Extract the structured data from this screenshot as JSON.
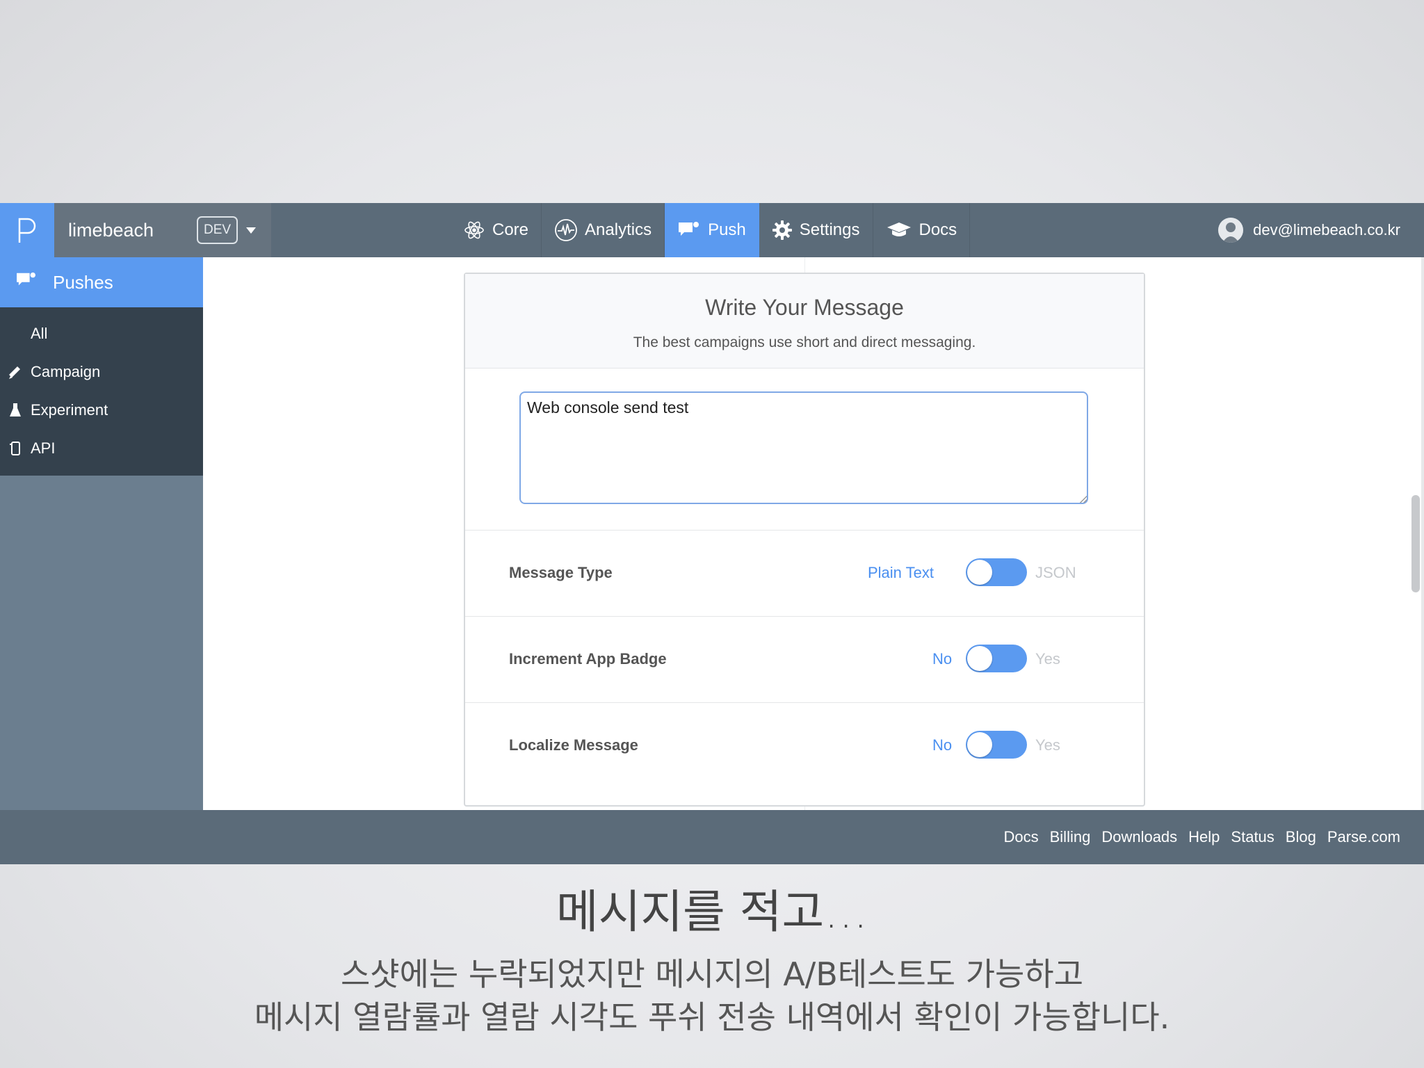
{
  "app": {
    "name": "limebeach",
    "environment": "DEV",
    "user_email": "dev@limebeach.co.kr"
  },
  "nav": {
    "items": [
      {
        "label": "Core",
        "icon": "atom-icon"
      },
      {
        "label": "Analytics",
        "icon": "pulse-icon"
      },
      {
        "label": "Push",
        "icon": "chat-bubble-icon",
        "active": true
      },
      {
        "label": "Settings",
        "icon": "gear-icon"
      },
      {
        "label": "Docs",
        "icon": "graduation-cap-icon"
      }
    ]
  },
  "sidebar": {
    "header": "Pushes",
    "items": [
      {
        "label": "All",
        "icon": ""
      },
      {
        "label": "Campaign",
        "icon": "megaphone-icon"
      },
      {
        "label": "Experiment",
        "icon": "flask-icon"
      },
      {
        "label": "API",
        "icon": "phone-icon"
      }
    ]
  },
  "card": {
    "title": "Write Your Message",
    "subtitle": "The best campaigns use short and direct messaging.",
    "message_value": "Web console send test"
  },
  "options": [
    {
      "label": "Message Type",
      "left": "Plain Text",
      "right": "JSON",
      "selected": "Plain Text"
    },
    {
      "label": "Increment App Badge",
      "left": "No",
      "right": "Yes",
      "selected": "No"
    },
    {
      "label": "Localize Message",
      "left": "No",
      "right": "Yes",
      "selected": "No"
    }
  ],
  "footer": {
    "links": [
      "Docs",
      "Billing",
      "Downloads",
      "Help",
      "Status",
      "Blog",
      "Parse.com"
    ]
  },
  "caption": {
    "title": "메시지를 적고...",
    "line1": "스샷에는 누락되었지만 메시지의 A/B테스트도 가능하고",
    "line2": "메시지 열람률과 열람 시각도 푸쉬 전송 내역에서 확인이 가능합니다."
  },
  "colors": {
    "accent": "#5b9af0",
    "topbar": "#5b6b79",
    "sidebar_dark": "#34414d"
  }
}
